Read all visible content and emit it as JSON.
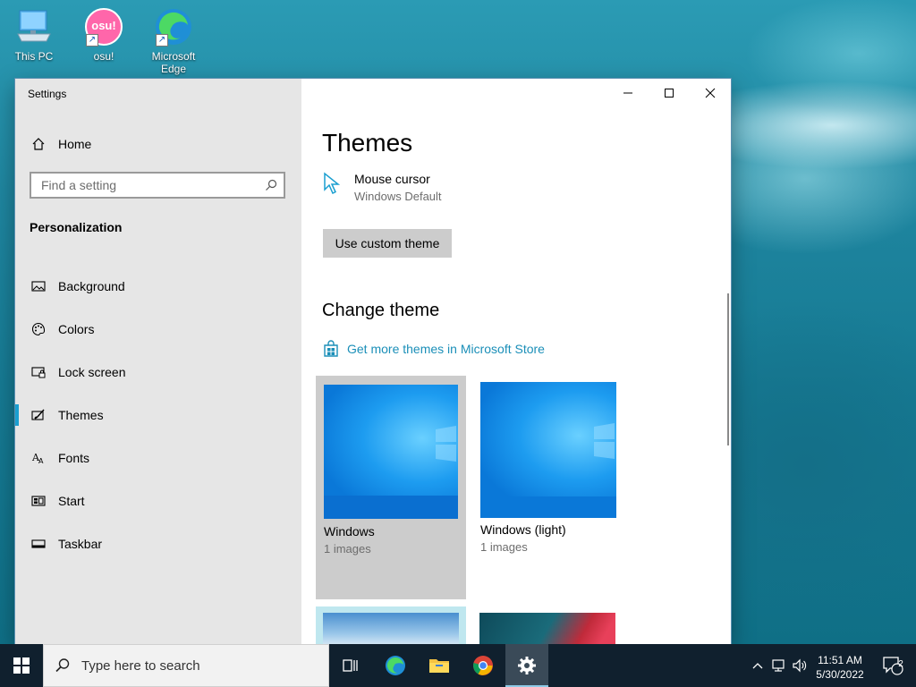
{
  "desktop": {
    "icons": [
      {
        "label": "This PC"
      },
      {
        "label": "osu!",
        "badge_text": "osu!"
      },
      {
        "label": "Microsoft Edge"
      }
    ]
  },
  "window": {
    "title": "Settings",
    "sidebar": {
      "home_label": "Home",
      "search_placeholder": "Find a setting",
      "section_heading": "Personalization",
      "items": [
        {
          "label": "Background",
          "icon": "picture-icon"
        },
        {
          "label": "Colors",
          "icon": "palette-icon"
        },
        {
          "label": "Lock screen",
          "icon": "lock-screen-icon"
        },
        {
          "label": "Themes",
          "icon": "themes-icon",
          "active": true
        },
        {
          "label": "Fonts",
          "icon": "fonts-icon"
        },
        {
          "label": "Start",
          "icon": "start-icon"
        },
        {
          "label": "Taskbar",
          "icon": "taskbar-icon"
        }
      ]
    },
    "content": {
      "page_title": "Themes",
      "mouse_cursor": {
        "title": "Mouse cursor",
        "value": "Windows Default"
      },
      "custom_theme_button": "Use custom theme",
      "change_theme_heading": "Change theme",
      "store_link": "Get more themes in Microsoft Store",
      "themes": [
        {
          "name": "Windows",
          "count": "1 images",
          "selected": true
        },
        {
          "name": "Windows (light)",
          "count": "1 images",
          "selected": false
        }
      ]
    }
  },
  "taskbar": {
    "search_placeholder": "Type here to search",
    "time": "11:51 AM",
    "date": "5/30/2022",
    "notification_count": "2"
  },
  "colors": {
    "accent": "#1a9fd0",
    "link": "#1b8fb8",
    "taskbar_bg": "#10202e",
    "sidebar_bg": "#e6e6e6"
  }
}
